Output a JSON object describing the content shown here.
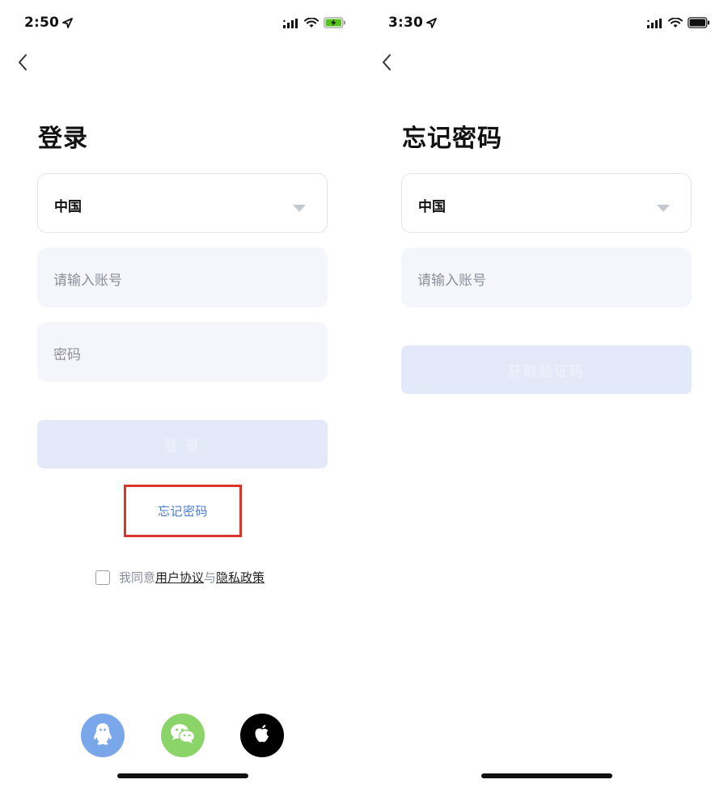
{
  "colors": {
    "accent_link": "#4a7dd8",
    "button_disabled_bg": "#e4e9f9",
    "input_bg": "#f5f6fb",
    "highlight_box": "#d9362b",
    "qq_bg": "#7aa7e9",
    "wechat_bg": "#8bd46a",
    "apple_bg": "#000000"
  },
  "left_screen": {
    "status_bar": {
      "time": "2:50",
      "battery_state": "charging",
      "icons": [
        "location-icon",
        "signal-icon",
        "wifi-icon",
        "battery-charging-icon"
      ]
    },
    "back_icon": "chevron-left-icon",
    "title": "登录",
    "country_select": {
      "value": "中国"
    },
    "account_input": {
      "placeholder": "请输入账号",
      "value": ""
    },
    "password_input": {
      "placeholder": "密码",
      "value": ""
    },
    "login_button": {
      "label": "登 录",
      "enabled": false
    },
    "forgot_password_link": "忘记密码",
    "agreement": {
      "prefix": "我同意",
      "user_agreement": "用户协议",
      "conjunction": "与",
      "privacy_policy": "隐私政策",
      "checked": false
    },
    "social_login": [
      {
        "name": "qq",
        "icon": "qq-icon"
      },
      {
        "name": "wechat",
        "icon": "wechat-icon"
      },
      {
        "name": "apple",
        "icon": "apple-icon"
      }
    ]
  },
  "right_screen": {
    "status_bar": {
      "time": "3:30",
      "battery_state": "full",
      "icons": [
        "location-icon",
        "signal-icon",
        "wifi-icon",
        "battery-icon"
      ]
    },
    "back_icon": "chevron-left-icon",
    "title": "忘记密码",
    "country_select": {
      "value": "中国"
    },
    "account_input": {
      "placeholder": "请输入账号",
      "value": ""
    },
    "get_code_button": {
      "label": "获取验证码",
      "enabled": false
    }
  }
}
